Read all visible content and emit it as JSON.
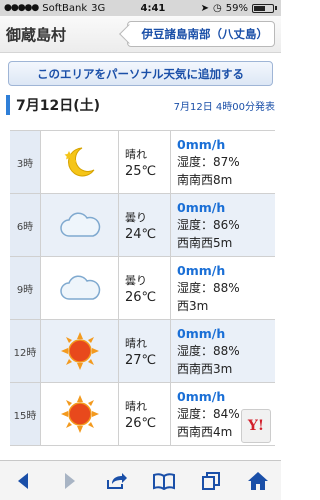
{
  "status": {
    "carrier": "SoftBank",
    "network": "3G",
    "time": "4:41",
    "battery": "59%"
  },
  "header": {
    "village": "御蔵島村",
    "region_button": "伊豆諸島南部（八丈島）"
  },
  "add_button": "このエリアをパーソナル天気に追加する",
  "date": {
    "main": "7月12日(土)",
    "published": "7月12日 4時00分発表"
  },
  "rows": [
    {
      "time": "3時",
      "icon": "moon-icon",
      "cond": "晴れ",
      "temp": "25℃",
      "precip": "0mm/h",
      "humidity": "湿度：87%",
      "wind": "南南西8m"
    },
    {
      "time": "6時",
      "icon": "cloud-icon",
      "cond": "曇り",
      "temp": "24℃",
      "precip": "0mm/h",
      "humidity": "湿度：86%",
      "wind": "西南西5m"
    },
    {
      "time": "9時",
      "icon": "cloud-icon",
      "cond": "曇り",
      "temp": "26℃",
      "precip": "0mm/h",
      "humidity": "湿度：88%",
      "wind": "西3m"
    },
    {
      "time": "12時",
      "icon": "sun-icon",
      "cond": "晴れ",
      "temp": "27℃",
      "precip": "0mm/h",
      "humidity": "湿度：88%",
      "wind": "西南西3m"
    },
    {
      "time": "15時",
      "icon": "sun-icon",
      "cond": "晴れ",
      "temp": "26℃",
      "precip": "0mm/h",
      "humidity": "湿度：84%",
      "wind": "西南西4m"
    }
  ],
  "badge": "Y!",
  "colors": {
    "accent": "#1a4fa8",
    "precip": "#1a6fd6",
    "row_alt": "#eaf0f8"
  }
}
